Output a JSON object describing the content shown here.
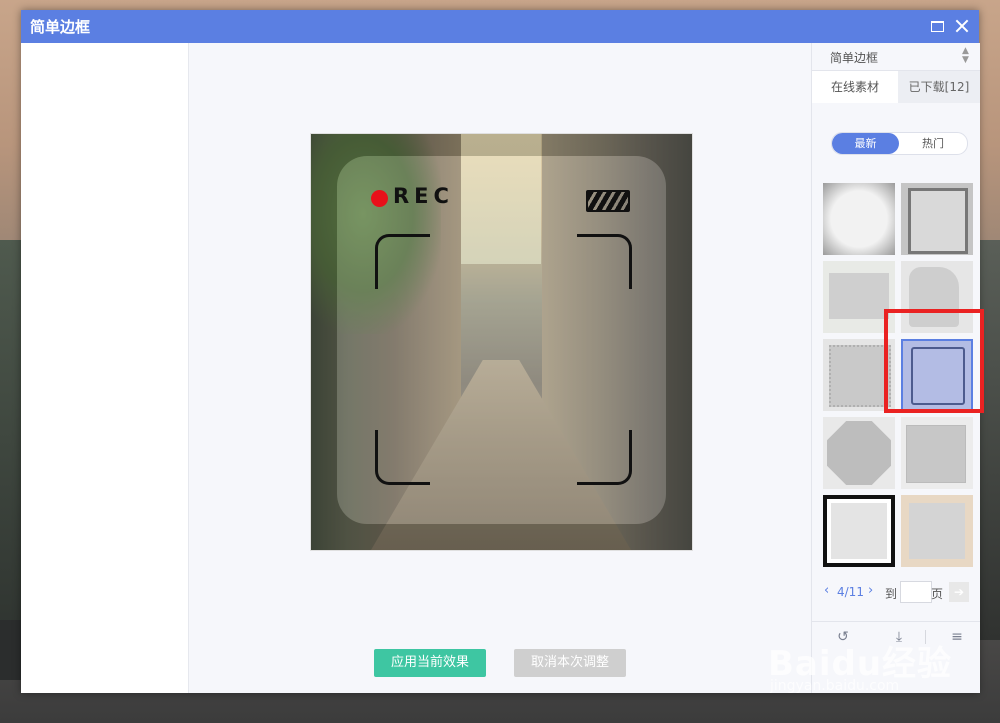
{
  "window": {
    "title": "简单边框"
  },
  "right_panel": {
    "dropdown_label": "简单边框",
    "tabs": [
      {
        "label": "在线素材"
      },
      {
        "label": "已下载[12]"
      }
    ],
    "filters": [
      {
        "label": "最新"
      },
      {
        "label": "热门"
      }
    ],
    "selected_filter": "最新",
    "thumbnails_count_visible": 10,
    "selected_thumbnail_index": 5,
    "pager": {
      "current": "4/11",
      "goto_label": "到",
      "unit_label": "页",
      "input_value": ""
    }
  },
  "preview": {
    "rec_label": "REC"
  },
  "actions": {
    "apply_label": "应用当前效果",
    "cancel_label": "取消本次调整"
  },
  "watermark": {
    "brand": "Baidu经验",
    "site": "jingyan.baidu.com"
  },
  "colors": {
    "accent": "#5b7fe2",
    "apply": "#3ec6a2",
    "highlight": "#ea2222"
  }
}
